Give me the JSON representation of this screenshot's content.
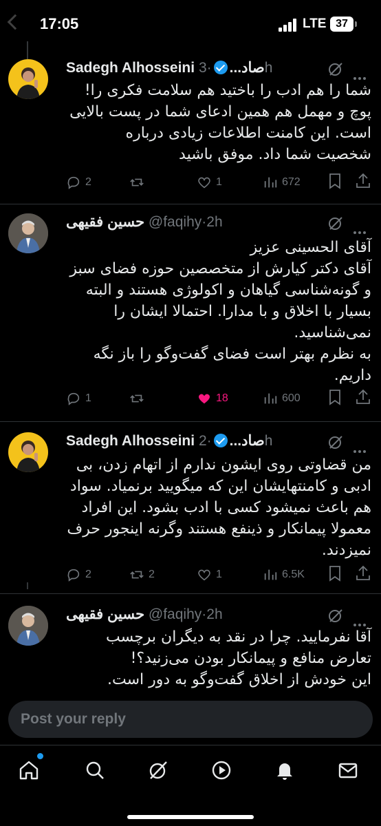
{
  "status_bar": {
    "time": "17:05",
    "network": "LTE",
    "battery": "37"
  },
  "tweets": [
    {
      "name": "Sadegh Alhosseini",
      "name_fa": "صاد...",
      "time": "3h",
      "body": "شما را هم ادب را باختید هم سلامت فکری را! پوچ و مهمل هم همین ادعای شما در پست بالایی است. این کامنت اطلاعات زیادی درباره شخصیت شما داد. موفق باشید",
      "replies": "2",
      "reposts": "",
      "likes": "1",
      "views": "672"
    },
    {
      "name": "حسین فقیهی",
      "handle": "@faqihy",
      "time": "2h",
      "body": "آقای الحسینی عزیز\nآقای دکتر کیارش از متخصصین حوزه فضای سبز و گونه‌شناسی گیاهان و اکولوژی هستند و البته بسیار با اخلاق و با مدارا. احتمالا ایشان را نمی‌شناسید.\nبه نظرم بهتر است فضای گفت‌وگو را باز نگه داریم.",
      "replies": "1",
      "reposts": "",
      "likes": "18",
      "views": "600"
    },
    {
      "name": "Sadegh Alhosseini",
      "name_fa": "صاد...",
      "time": "2h",
      "body": "من قضاوتی روی ایشون ندارم از اتهام زدن، بی ادبی و کامنتهایشان این که میگویید برنمیاد. سواد هم باعث نمیشود کسی با ادب بشود. این افراد معمولا پیمانکار و ذینفع هستند وگرنه اینجور حرف نمیزدند.",
      "replies": "2",
      "reposts": "2",
      "likes": "1",
      "views": "6.5K"
    },
    {
      "name": "حسین فقیهی",
      "handle": "@faqihy",
      "time": "2h",
      "body": "آقا نفرمایید. چرا در نقد به دیگران برچسب تعارض منافع و پیمانکار بودن می‌زنید؟!\nاین خودش از اخلاق گفت‌وگو به دور است."
    }
  ],
  "reply_placeholder": "Post your reply",
  "colors": {
    "accent": "#1d9bf0",
    "like": "#f91880",
    "muted": "#71767b",
    "avatar_yellow": "#f4c21b"
  },
  "nav_icons": [
    "home-icon",
    "search-icon",
    "grok-icon",
    "video-icon",
    "notifications-icon",
    "messages-icon"
  ]
}
